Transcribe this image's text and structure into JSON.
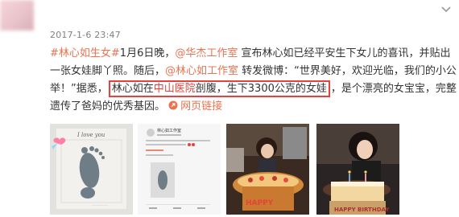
{
  "post": {
    "timestamp": "2017-1-6 23:47",
    "hashtag": "#林心如生女#",
    "text1": "1月6日晚，",
    "mention1": "@华杰工作室",
    "text2": " 宣布林心如已经平安生下女儿的喜讯，并贴出一张女娃脚丫照。随后，",
    "mention2": "@林心如工作室",
    "text3": " 转发微博：“世界美好，欢迎光临，我们的小公举！”据悉，",
    "box_pre": "林心如在",
    "box_red": "中山医院",
    "box_post": "剖腹，生下3300公克的女娃",
    "text4": "，是个漂亮的女宝宝，完整遗传了爸妈的优秀基因。",
    "link_label": "网页链接"
  },
  "thumbs": {
    "img1_text": "I love you",
    "img2_title": "林心如工作室",
    "img4_text": "HAPPY BIRTHDAY"
  },
  "colors": {
    "link": "#eb7350",
    "highlight_box": "#e8403c",
    "timestamp": "#808080"
  }
}
